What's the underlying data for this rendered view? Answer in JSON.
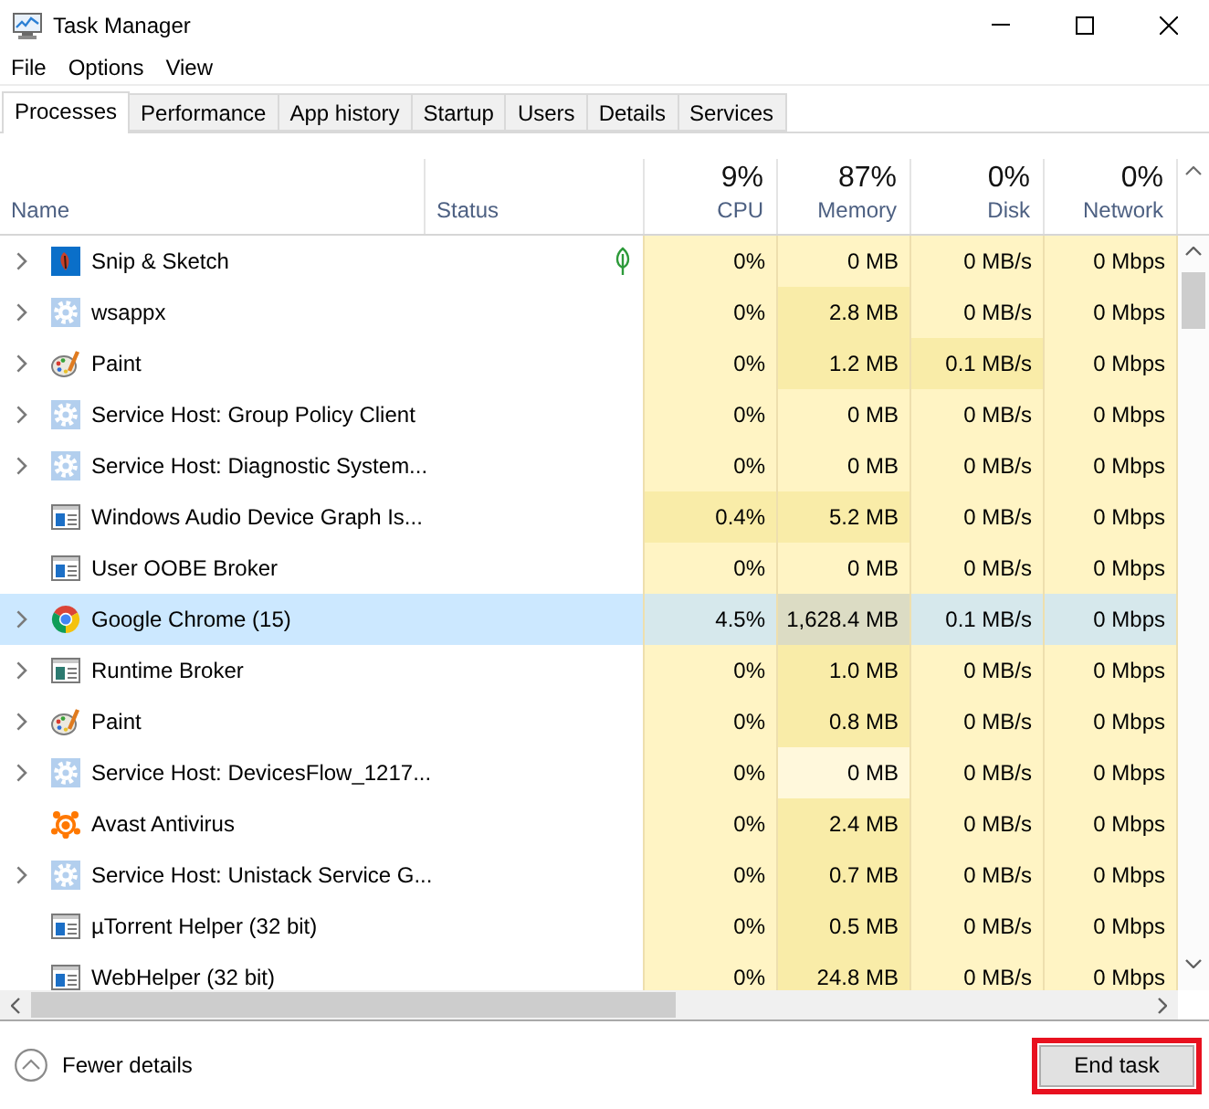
{
  "window": {
    "title": "Task Manager"
  },
  "menu": [
    {
      "label": "File"
    },
    {
      "label": "Options"
    },
    {
      "label": "View"
    }
  ],
  "tabs": [
    {
      "label": "Processes",
      "selected": true
    },
    {
      "label": "Performance",
      "selected": false
    },
    {
      "label": "App history",
      "selected": false
    },
    {
      "label": "Startup",
      "selected": false
    },
    {
      "label": "Users",
      "selected": false
    },
    {
      "label": "Details",
      "selected": false
    },
    {
      "label": "Services",
      "selected": false
    }
  ],
  "columns": [
    {
      "label": "Name"
    },
    {
      "label": "Status"
    },
    {
      "label": "CPU",
      "total": "9%"
    },
    {
      "label": "Memory",
      "total": "87%"
    },
    {
      "label": "Disk",
      "total": "0%"
    },
    {
      "label": "Network",
      "total": "0%"
    }
  ],
  "rows": [
    {
      "name": "Snip & Sketch",
      "kind": "snip",
      "expandable": true,
      "suspended": true,
      "selected": false,
      "cells": [
        {
          "text": "0%",
          "color": "#fff4c4"
        },
        {
          "text": "0 MB",
          "color": "#fff4c4"
        },
        {
          "text": "0 MB/s",
          "color": "#fff4c4"
        },
        {
          "text": "0 Mbps",
          "color": "#fff4c4"
        }
      ]
    },
    {
      "name": "wsappx",
      "kind": "gear",
      "expandable": true,
      "suspended": false,
      "selected": false,
      "cells": [
        {
          "text": "0%",
          "color": "#fff4c4"
        },
        {
          "text": "2.8 MB",
          "color": "#f9eca8"
        },
        {
          "text": "0 MB/s",
          "color": "#fff4c4"
        },
        {
          "text": "0 Mbps",
          "color": "#fff4c4"
        }
      ]
    },
    {
      "name": "Paint",
      "kind": "paint",
      "expandable": true,
      "suspended": false,
      "selected": false,
      "cells": [
        {
          "text": "0%",
          "color": "#fff4c4"
        },
        {
          "text": "1.2 MB",
          "color": "#f9eca8"
        },
        {
          "text": "0.1 MB/s",
          "color": "#f9eca8"
        },
        {
          "text": "0 Mbps",
          "color": "#fff4c4"
        }
      ]
    },
    {
      "name": "Service Host: Group Policy Client",
      "kind": "gear",
      "expandable": true,
      "suspended": false,
      "selected": false,
      "cells": [
        {
          "text": "0%",
          "color": "#fff4c4"
        },
        {
          "text": "0 MB",
          "color": "#fff4c4"
        },
        {
          "text": "0 MB/s",
          "color": "#fff4c4"
        },
        {
          "text": "0 Mbps",
          "color": "#fff4c4"
        }
      ]
    },
    {
      "name": "Service Host: Diagnostic System...",
      "kind": "gear",
      "expandable": true,
      "suspended": false,
      "selected": false,
      "cells": [
        {
          "text": "0%",
          "color": "#fff4c4"
        },
        {
          "text": "0 MB",
          "color": "#fff4c4"
        },
        {
          "text": "0 MB/s",
          "color": "#fff4c4"
        },
        {
          "text": "0 Mbps",
          "color": "#fff4c4"
        }
      ]
    },
    {
      "name": "Windows Audio Device Graph Is...",
      "kind": "window",
      "expandable": false,
      "suspended": false,
      "selected": false,
      "cells": [
        {
          "text": "0.4%",
          "color": "#f9eca8"
        },
        {
          "text": "5.2 MB",
          "color": "#f9eca8"
        },
        {
          "text": "0 MB/s",
          "color": "#fff4c4"
        },
        {
          "text": "0 Mbps",
          "color": "#fff4c4"
        }
      ]
    },
    {
      "name": "User OOBE Broker",
      "kind": "window",
      "expandable": false,
      "suspended": false,
      "selected": false,
      "cells": [
        {
          "text": "0%",
          "color": "#fff4c4"
        },
        {
          "text": "0 MB",
          "color": "#fff4c4"
        },
        {
          "text": "0 MB/s",
          "color": "#fff4c4"
        },
        {
          "text": "0 Mbps",
          "color": "#fff4c4"
        }
      ]
    },
    {
      "name": "Google Chrome (15)",
      "kind": "chrome",
      "expandable": true,
      "suspended": false,
      "selected": true,
      "cells": [
        {
          "text": "4.5%",
          "color": "#d6e8ec"
        },
        {
          "text": "1,628.4 MB",
          "color": "#dcdcc4"
        },
        {
          "text": "0.1 MB/s",
          "color": "#d6e8ec"
        },
        {
          "text": "0 Mbps",
          "color": "#d6e8ec"
        }
      ]
    },
    {
      "name": "Runtime Broker",
      "kind": "broker",
      "expandable": true,
      "suspended": false,
      "selected": false,
      "cells": [
        {
          "text": "0%",
          "color": "#fff4c4"
        },
        {
          "text": "1.0 MB",
          "color": "#f9eca8"
        },
        {
          "text": "0 MB/s",
          "color": "#fff4c4"
        },
        {
          "text": "0 Mbps",
          "color": "#fff4c4"
        }
      ]
    },
    {
      "name": "Paint",
      "kind": "paint",
      "expandable": true,
      "suspended": false,
      "selected": false,
      "cells": [
        {
          "text": "0%",
          "color": "#fff4c4"
        },
        {
          "text": "0.8 MB",
          "color": "#f9eca8"
        },
        {
          "text": "0 MB/s",
          "color": "#fff4c4"
        },
        {
          "text": "0 Mbps",
          "color": "#fff4c4"
        }
      ]
    },
    {
      "name": "Service Host: DevicesFlow_1217...",
      "kind": "gear",
      "expandable": true,
      "suspended": false,
      "selected": false,
      "cells": [
        {
          "text": "0%",
          "color": "#fff4c4"
        },
        {
          "text": "0 MB",
          "color": "#fff8dc"
        },
        {
          "text": "0 MB/s",
          "color": "#fff4c4"
        },
        {
          "text": "0 Mbps",
          "color": "#fff4c4"
        }
      ]
    },
    {
      "name": "Avast Antivirus",
      "kind": "avast",
      "expandable": false,
      "suspended": false,
      "selected": false,
      "cells": [
        {
          "text": "0%",
          "color": "#fff4c4"
        },
        {
          "text": "2.4 MB",
          "color": "#f9eca8"
        },
        {
          "text": "0 MB/s",
          "color": "#fff4c4"
        },
        {
          "text": "0 Mbps",
          "color": "#fff4c4"
        }
      ]
    },
    {
      "name": "Service Host: Unistack Service G...",
      "kind": "gear",
      "expandable": true,
      "suspended": false,
      "selected": false,
      "cells": [
        {
          "text": "0%",
          "color": "#fff4c4"
        },
        {
          "text": "0.7 MB",
          "color": "#f9eca8"
        },
        {
          "text": "0 MB/s",
          "color": "#fff4c4"
        },
        {
          "text": "0 Mbps",
          "color": "#fff4c4"
        }
      ]
    },
    {
      "name": "µTorrent Helper (32 bit)",
      "kind": "window",
      "expandable": false,
      "suspended": false,
      "selected": false,
      "cells": [
        {
          "text": "0%",
          "color": "#fff4c4"
        },
        {
          "text": "0.5 MB",
          "color": "#f9eca8"
        },
        {
          "text": "0 MB/s",
          "color": "#fff4c4"
        },
        {
          "text": "0 Mbps",
          "color": "#fff4c4"
        }
      ]
    },
    {
      "name": "WebHelper (32 bit)",
      "kind": "window",
      "expandable": false,
      "suspended": false,
      "selected": false,
      "cells": [
        {
          "text": "0%",
          "color": "#fff4c4"
        },
        {
          "text": "24.8 MB",
          "color": "#f9eca8"
        },
        {
          "text": "0 MB/s",
          "color": "#fff4c4"
        },
        {
          "text": "0 Mbps",
          "color": "#fff4c4"
        }
      ]
    }
  ],
  "footer": {
    "toggle": "Fewer details",
    "button": "End task",
    "highlighted": true
  }
}
